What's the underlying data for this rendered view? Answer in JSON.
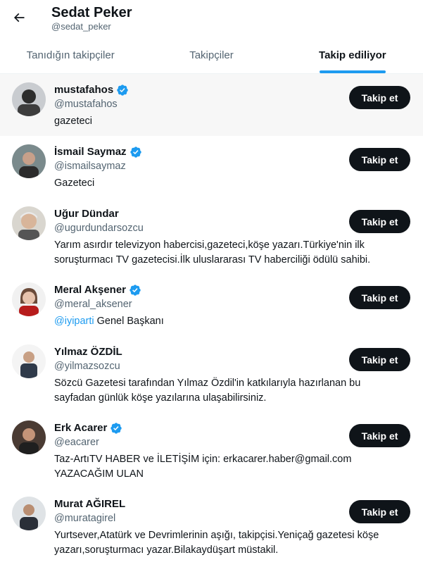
{
  "header": {
    "title": "Sedat Peker",
    "handle": "@sedat_peker",
    "back_icon": "arrow-left-icon"
  },
  "tabs": [
    {
      "label": "Tanıdığın takipçiler",
      "active": false
    },
    {
      "label": "Takipçiler",
      "active": false
    },
    {
      "label": "Takip ediliyor",
      "active": true
    }
  ],
  "colors": {
    "accent": "#1d9bf0",
    "button_bg": "#0f1419",
    "secondary_text": "#536471",
    "hover_row": "#f7f7f7"
  },
  "follow_label": "Takip et",
  "users": [
    {
      "name": "mustafahos",
      "handle": "@mustafahos",
      "verified": true,
      "bio": "gazeteci"
    },
    {
      "name": "İsmail Saymaz",
      "handle": "@ismailsaymaz",
      "verified": true,
      "bio": "Gazeteci"
    },
    {
      "name": "Uğur Dündar",
      "handle": "@ugurdundarsozcu",
      "verified": false,
      "bio_lines": [
        "Yarım asırdır televizyon habercisi,gazeteci,köşe yazarı.Türkiye'nin ilk",
        "soruşturmacı TV gazetecisi.İlk uluslararası TV haberciliği ödülü sahibi."
      ]
    },
    {
      "name": "Meral Akşener",
      "handle": "@meral_aksener",
      "verified": true,
      "bio_link": "@iyiparti",
      "bio_rest": " Genel Başkanı"
    },
    {
      "name": "Yılmaz ÖZDİL",
      "handle": "@yilmazsozcu",
      "verified": false,
      "bio_lines": [
        "Sözcü Gazetesi tarafından Yılmaz Özdil'in katkılarıyla hazırlanan bu",
        "sayfadan günlük köşe yazılarına ulaşabilirsiniz."
      ]
    },
    {
      "name": "Erk Acarer",
      "handle": "@eacarer",
      "verified": true,
      "bio_lines": [
        "Taz-ArtıTV HABER ve İLETİŞİM için: erkacarer.haber@gmail.com",
        "YAZACAĞIM ULAN"
      ]
    },
    {
      "name": "Murat AĞIREL",
      "handle": "@muratagirel",
      "verified": false,
      "bio_lines": [
        "Yurtsever,Atatürk ve Devrimlerinin aşığı, takipçisi.Yeniçağ gazetesi köşe",
        "yazarı,soruşturmacı yazar.Bilakaydüşart müstakil."
      ]
    }
  ]
}
